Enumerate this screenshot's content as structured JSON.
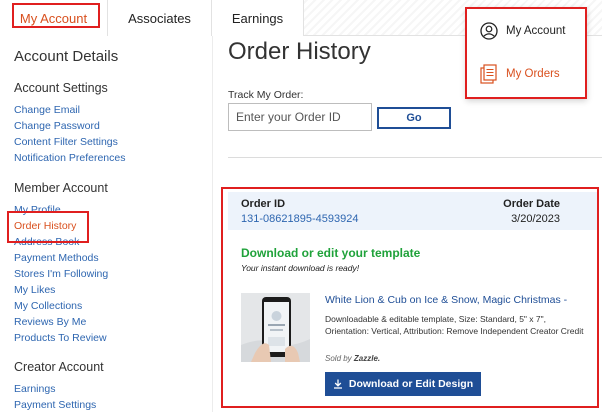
{
  "tabs": [
    {
      "label": "My Account",
      "active": true
    },
    {
      "label": "Associates",
      "active": false
    },
    {
      "label": "Earnings",
      "active": false
    }
  ],
  "sidebar": {
    "title": "Account Details",
    "sections": [
      {
        "title": "Account Settings",
        "items": [
          "Change Email",
          "Change Password",
          "Content Filter Settings",
          "Notification Preferences"
        ]
      },
      {
        "title": "Member Account",
        "items": [
          "My Profile",
          "Order History",
          "Address Book",
          "Payment Methods",
          "Stores I'm Following",
          "My Likes",
          "My Collections",
          "Reviews By Me",
          "Products To Review"
        ]
      },
      {
        "title": "Creator Account",
        "items": [
          "Earnings",
          "Payment Settings"
        ]
      }
    ],
    "active_item": "Order History"
  },
  "main": {
    "title": "Order History",
    "track_label": "Track My Order:",
    "order_input_placeholder": "Enter your Order ID",
    "go_label": "Go"
  },
  "order": {
    "id_label": "Order ID",
    "id_value": "131-08621895-4593924",
    "date_label": "Order Date",
    "date_value": "3/20/2023",
    "download_heading": "Download or edit your template",
    "download_subtext": "Your instant download is ready!",
    "product_title": "White Lion & Cub on Ice & Snow, Magic Christmas -",
    "product_desc": "Downloadable & editable template, Size: Standard, 5\" x 7\", Orientation: Vertical, Attribution: Remove Independent Creator Credit",
    "sold_by_prefix": "Sold by",
    "sold_by_brand": "Zazzle.",
    "download_button": "Download or Edit Design"
  },
  "account_menu": {
    "items": [
      {
        "label": "My Account",
        "icon": "user-circle-icon"
      },
      {
        "label": "My Orders",
        "icon": "orders-list-icon"
      }
    ]
  },
  "colors": {
    "accent_orange": "#d9501e",
    "link_blue": "#2e66b0",
    "button_navy": "#1f4e96",
    "success_green": "#1fa23a",
    "highlight_red": "#e01f1f"
  }
}
